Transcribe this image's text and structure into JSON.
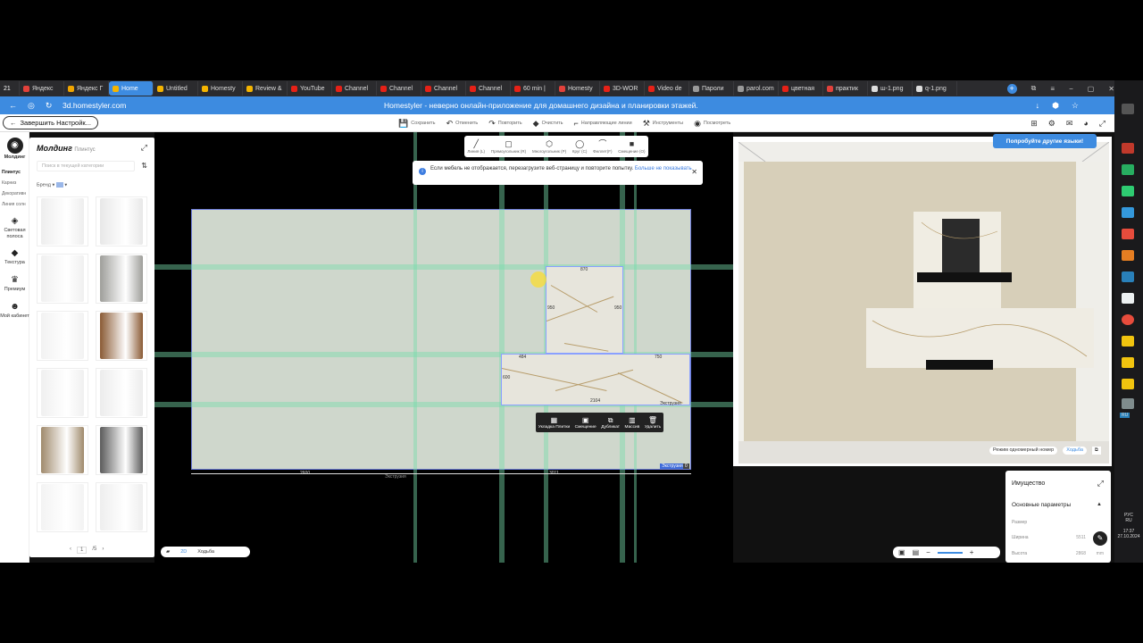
{
  "browser": {
    "tabs": [
      {
        "label": "Яндекс",
        "color": "#e2413b",
        "active": false
      },
      {
        "label": "Яндекс Г",
        "color": "#f0a500",
        "active": false
      },
      {
        "label": "Home",
        "color": "#f5b400",
        "active": true
      },
      {
        "label": "Untitled",
        "color": "#f5b400",
        "active": false
      },
      {
        "label": "Homesty",
        "color": "#f5b400",
        "active": false
      },
      {
        "label": "Review &",
        "color": "#f5b400",
        "active": false
      },
      {
        "label": "YouTube",
        "color": "#e62117",
        "active": false
      },
      {
        "label": "Channel",
        "color": "#e62117",
        "active": false
      },
      {
        "label": "Channel",
        "color": "#e62117",
        "active": false
      },
      {
        "label": "Channel",
        "color": "#e62117",
        "active": false
      },
      {
        "label": "Channel",
        "color": "#e62117",
        "active": false
      },
      {
        "label": "60 min |",
        "color": "#e62117",
        "active": false
      },
      {
        "label": "Homesty",
        "color": "#e2413b",
        "active": false
      },
      {
        "label": "3D-WOR",
        "color": "#e62117",
        "active": false
      },
      {
        "label": "Video de",
        "color": "#e62117",
        "active": false
      },
      {
        "label": "Пароли",
        "color": "#999999",
        "active": false
      },
      {
        "label": "parol.com",
        "color": "#999999",
        "active": false
      },
      {
        "label": "цветная",
        "color": "#e62117",
        "active": false
      },
      {
        "label": "практик",
        "color": "#e2413b",
        "active": false
      },
      {
        "label": "ш-1.png",
        "color": "#dddddd",
        "active": false
      },
      {
        "label": "q-1.png",
        "color": "#dddddd",
        "active": false
      }
    ],
    "tab_count": "21",
    "url": "3d.homestyler.com",
    "page_title": "Homestyler - неверно онлайн-приложение для домашнего дизайна и планировки этажей."
  },
  "toolbar": {
    "finish_label": "Завершить Настройк...",
    "items": [
      {
        "icon": "save-icon",
        "label": "Сохранить"
      },
      {
        "icon": "undo-icon",
        "label": "Отменить"
      },
      {
        "icon": "redo-icon",
        "label": "Повторить"
      },
      {
        "icon": "eraser-icon",
        "label": "Очистить"
      },
      {
        "icon": "guides-icon",
        "label": "Направляющие линии"
      },
      {
        "icon": "tools-icon",
        "label": "Инструменты"
      },
      {
        "icon": "eye-icon",
        "label": "Посмотреть"
      }
    ]
  },
  "rail": {
    "items": [
      {
        "label": "Молдинг",
        "icon": "molding-icon"
      },
      {
        "label": "Световая полоса",
        "icon": "light-strip-icon"
      },
      {
        "label": "Текстура",
        "icon": "texture-icon"
      },
      {
        "label": "Премиум",
        "icon": "premium-icon"
      },
      {
        "label": "Мой кабинет",
        "icon": "cabinet-icon"
      }
    ],
    "subitems": [
      "Плинтус",
      "Карниз",
      "Декоративн",
      "Линия солн"
    ]
  },
  "catalog": {
    "title": "Молдинг",
    "subtitle": "Плинтус",
    "search_placeholder": "Поиск в текущей категории",
    "brand_label": "Бренд",
    "page": "1",
    "page_total": "/5",
    "thumbs": [
      "#eeeeee",
      "#e8e8e8",
      "#f0f0f0",
      "#9e9e9a",
      "#f2f2f2",
      "#8a5a34",
      "#f0f0f0",
      "#ececec",
      "#a08a6c",
      "#5b5b5b",
      "#f3f3f3",
      "#eeeeee"
    ]
  },
  "draw_tools": [
    {
      "icon": "line-icon",
      "label": "Линия (L)"
    },
    {
      "icon": "rect-icon",
      "label": "Прямоугольник (R)"
    },
    {
      "icon": "polygon-icon",
      "label": "Многоугольник (P)"
    },
    {
      "icon": "circle-icon",
      "label": "Круг (C)"
    },
    {
      "icon": "fillet-icon",
      "label": "Филлет(F)"
    },
    {
      "icon": "offset-icon",
      "label": "Смещение (O)"
    }
  ],
  "hint": {
    "text": "Если мебель не отображается, перезагрузите веб-страницу и повторите попытку.",
    "more": "Больше не показывать"
  },
  "dimensions": {
    "top": "870",
    "left": "950",
    "right": "950",
    "short_left": "484",
    "short_right": "750",
    "height": "600",
    "bottom": "2104",
    "wall_left": "2600",
    "wall_right": "3011",
    "extrude": "Экструзия",
    "zero": "0"
  },
  "action_bar": [
    {
      "icon": "tile-layout-icon",
      "label": "Укладка Плитки"
    },
    {
      "icon": "offset-icon",
      "label": "Смещение"
    },
    {
      "icon": "duplicate-icon",
      "label": "Дубликат"
    },
    {
      "icon": "array-icon",
      "label": "Массив"
    },
    {
      "icon": "trash-icon",
      "label": "Удалить"
    }
  ],
  "canvas_footer": {
    "view": "2D",
    "walk": "Ходьба"
  },
  "preview": {
    "try_lang": "Попробуйте другие языки!",
    "mode": "Режим одномерный номер",
    "walk": "Ходьба"
  },
  "props": {
    "title": "Имущество",
    "section": "Основные параметры",
    "size": "Размер",
    "width_label": "Ширина",
    "width_value": "5511",
    "height_label": "Высота",
    "height_value": "2868",
    "unit": "mm"
  },
  "system": {
    "lang": "РУС",
    "kbd": "RU",
    "time": "17:37",
    "date": "27.10.2024"
  }
}
